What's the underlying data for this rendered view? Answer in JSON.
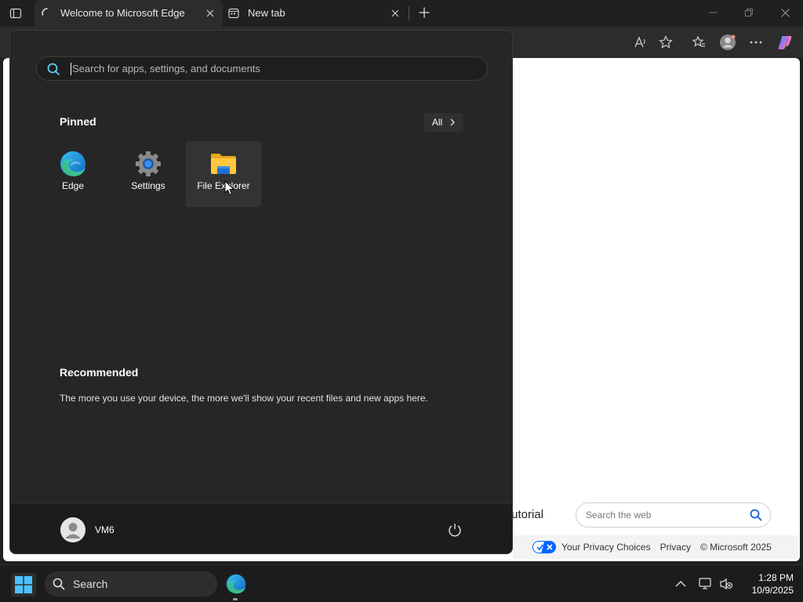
{
  "browser": {
    "tabs": [
      {
        "title": "Welcome to Microsoft Edge",
        "active": true
      },
      {
        "title": "New tab",
        "active": false
      }
    ]
  },
  "start_menu": {
    "search_placeholder": "Search for apps, settings, and documents",
    "pinned_title": "Pinned",
    "all_label": "All",
    "pinned_apps": [
      {
        "label": "Edge",
        "icon": "edge-icon"
      },
      {
        "label": "Settings",
        "icon": "settings-gear-icon"
      },
      {
        "label": "File Explorer",
        "icon": "folder-icon"
      }
    ],
    "recommended_title": "Recommended",
    "recommended_text": "The more you use your device, the more we'll show your recent files and new apps here.",
    "user_name": "VM6"
  },
  "webpage": {
    "partial_text": "tutorial",
    "search_placeholder": "Search the web",
    "footer": {
      "privacy_choices": "Your Privacy Choices",
      "privacy": "Privacy",
      "copyright": "© Microsoft 2025"
    }
  },
  "taskbar": {
    "search_label": "Search",
    "time": "1:28 PM",
    "date": "10/9/2025"
  },
  "colors": {
    "accent": "#60cdff",
    "start_bg": "#262626",
    "taskbar_bg": "#1c1c1c"
  }
}
